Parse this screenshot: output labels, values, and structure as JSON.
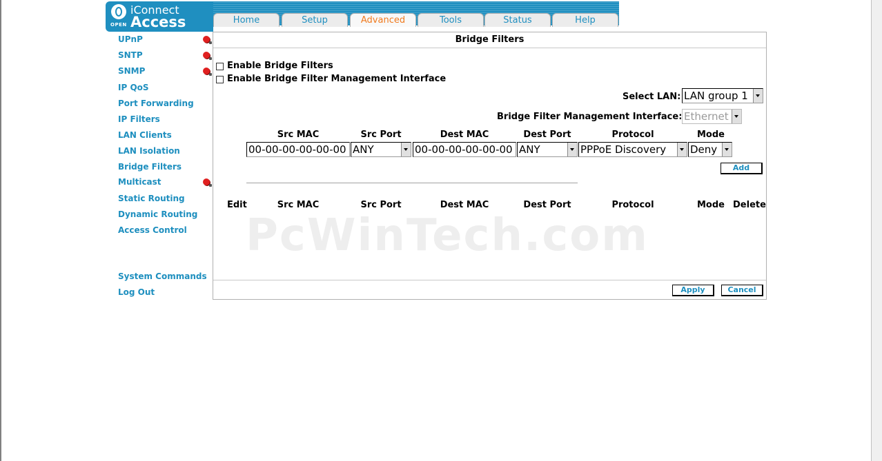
{
  "logo": {
    "line1": "iConnect",
    "line2": "Access",
    "badge": "OPEN"
  },
  "tabs": [
    {
      "label": "Home",
      "active": false
    },
    {
      "label": "Setup",
      "active": false
    },
    {
      "label": "Advanced",
      "active": true
    },
    {
      "label": "Tools",
      "active": false
    },
    {
      "label": "Status",
      "active": false
    },
    {
      "label": "Help",
      "active": false
    }
  ],
  "sidebar": {
    "items": [
      {
        "label": "UPnP",
        "flag": true
      },
      {
        "label": "SNTP",
        "flag": true
      },
      {
        "label": "SNMP",
        "flag": true
      },
      {
        "label": "IP QoS",
        "flag": false
      },
      {
        "label": "Port Forwarding",
        "flag": false
      },
      {
        "label": "IP Filters",
        "flag": false
      },
      {
        "label": "LAN Clients",
        "flag": false
      },
      {
        "label": "LAN Isolation",
        "flag": false
      },
      {
        "label": "Bridge Filters",
        "flag": false
      },
      {
        "label": "Multicast",
        "flag": true
      },
      {
        "label": "Static Routing",
        "flag": false
      },
      {
        "label": "Dynamic Routing",
        "flag": false
      },
      {
        "label": "Access Control",
        "flag": false
      }
    ],
    "system_commands": "System Commands",
    "log_out": "Log Out"
  },
  "panel": {
    "title": "Bridge Filters",
    "enable_bridge_filters": "Enable Bridge Filters",
    "enable_mgmt_interface": "Enable Bridge Filter Management Interface",
    "select_lan_label": "Select LAN:",
    "select_lan_value": "LAN group 1",
    "mgmt_interface_label": "Bridge Filter Management Interface:",
    "mgmt_interface_value": "Ethernet",
    "form_headers": {
      "src_mac": "Src MAC",
      "src_port": "Src Port",
      "dest_mac": "Dest MAC",
      "dest_port": "Dest Port",
      "protocol": "Protocol",
      "mode": "Mode"
    },
    "form_values": {
      "src_mac": "00-00-00-00-00-00",
      "src_port": "ANY",
      "dest_mac": "00-00-00-00-00-00",
      "dest_port": "ANY",
      "protocol": "PPPoE Discovery",
      "mode": "Deny"
    },
    "add_label": "Add",
    "table_headers": {
      "edit": "Edit",
      "src_mac": "Src MAC",
      "src_port": "Src Port",
      "dest_mac": "Dest MAC",
      "dest_port": "Dest Port",
      "protocol": "Protocol",
      "mode": "Mode",
      "delete": "Delete"
    },
    "watermark": "PcWinTech.com",
    "apply_label": "Apply",
    "cancel_label": "Cancel"
  },
  "colors": {
    "brand_blue": "#1f8fc0",
    "link_blue": "#1e8fbf",
    "active_tab": "#f07a1e"
  }
}
